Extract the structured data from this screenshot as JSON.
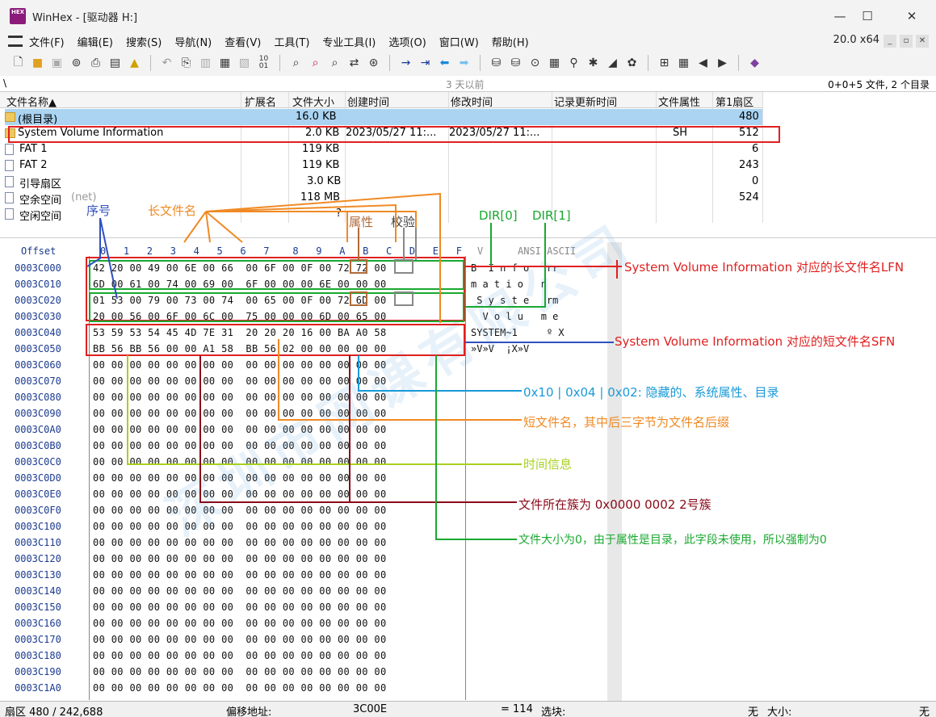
{
  "window": {
    "title": "WinHex - [驱动器 H:]",
    "icon_label": "HEX"
  },
  "menu": [
    "文件(F)",
    "编辑(E)",
    "搜索(S)",
    "导航(N)",
    "查看(V)",
    "工具(T)",
    "专业工具(I)",
    "选项(O)",
    "窗口(W)",
    "帮助(H)"
  ],
  "zoom": "20.0 x64",
  "path": {
    "left": "\\",
    "mid": "3 天以前",
    "right": "0+0+5 文件, 2 个目录"
  },
  "file_columns": [
    "文件名称▲",
    "扩展名",
    "文件大小",
    "创建时间",
    "修改时间",
    "记录更新时间",
    "文件属性",
    "第1扇区"
  ],
  "files": [
    {
      "name": "(根目录)",
      "ext": "",
      "size": "16.0 KB",
      "created": "",
      "modified": "",
      "attr": "",
      "sector": "480"
    },
    {
      "name": "System Volume Information",
      "ext": "",
      "size": "2.0 KB",
      "created": "2023/05/27  11:...",
      "modified": "2023/05/27  11:...",
      "attr": "SH",
      "sector": "512"
    },
    {
      "name": "FAT 1",
      "ext": "",
      "size": "119 KB",
      "created": "",
      "modified": "",
      "attr": "",
      "sector": "6"
    },
    {
      "name": "FAT 2",
      "ext": "",
      "size": "119 KB",
      "created": "",
      "modified": "",
      "attr": "",
      "sector": "243"
    },
    {
      "name": "引导扇区",
      "ext": "",
      "size": "3.0 KB",
      "created": "",
      "modified": "",
      "attr": "",
      "sector": "0"
    },
    {
      "name": "空余空间",
      "name_suffix": "(net)",
      "ext": "",
      "size": "118 MB",
      "created": "",
      "modified": "",
      "attr": "",
      "sector": "524"
    },
    {
      "name": "空闲空间",
      "ext": "",
      "size": "?",
      "created": "",
      "modified": "",
      "attr": "",
      "sector": ""
    }
  ],
  "hex": {
    "header_offset": "Offset",
    "header_cols": "0   1   2   3   4   5   6   7    8   9   A   B   C   D   E   F",
    "header_ascii": "ANSI ASCII",
    "header_v": "V",
    "rows": [
      {
        "off": "0003C000",
        "hex": "42 20 00 49 00 6E 00 66  00 6F 00 0F 00 72 72 00",
        "ascii": "B  I n f o   rr"
      },
      {
        "off": "0003C010",
        "hex": "6D 00 61 00 74 00 69 00  6F 00 00 00 6E 00 00 00",
        "ascii": "m a t i o   n"
      },
      {
        "off": "0003C020",
        "hex": "01 53 00 79 00 73 00 74  00 65 00 0F 00 72 6D 00",
        "ascii": " S y s t e   rm"
      },
      {
        "off": "0003C030",
        "hex": "20 00 56 00 6F 00 6C 00  75 00 00 00 6D 00 65 00",
        "ascii": "  V o l u   m e"
      },
      {
        "off": "0003C040",
        "hex": "53 59 53 54 45 4D 7E 31  20 20 20 16 00 BA A0 58",
        "ascii": "SYSTEM~1     º X"
      },
      {
        "off": "0003C050",
        "hex": "BB 56 BB 56 00 00 A1 58  BB 56 02 00 00 00 00 00",
        "ascii": "»V»V  ¡X»V"
      },
      {
        "off": "0003C060",
        "hex": "00 00 00 00 00 00 00 00  00 00 00 00 00 00 00 00",
        "ascii": ""
      },
      {
        "off": "0003C070",
        "hex": "00 00 00 00 00 00 00 00  00 00 00 00 00 00 00 00",
        "ascii": ""
      },
      {
        "off": "0003C080",
        "hex": "00 00 00 00 00 00 00 00  00 00 00 00 00 00 00 00",
        "ascii": ""
      },
      {
        "off": "0003C090",
        "hex": "00 00 00 00 00 00 00 00  00 00 00 00 00 00 00 00",
        "ascii": ""
      },
      {
        "off": "0003C0A0",
        "hex": "00 00 00 00 00 00 00 00  00 00 00 00 00 00 00 00",
        "ascii": ""
      },
      {
        "off": "0003C0B0",
        "hex": "00 00 00 00 00 00 00 00  00 00 00 00 00 00 00 00",
        "ascii": ""
      },
      {
        "off": "0003C0C0",
        "hex": "00 00 00 00 00 00 00 00  00 00 00 00 00 00 00 00",
        "ascii": ""
      },
      {
        "off": "0003C0D0",
        "hex": "00 00 00 00 00 00 00 00  00 00 00 00 00 00 00 00",
        "ascii": ""
      },
      {
        "off": "0003C0E0",
        "hex": "00 00 00 00 00 00 00 00  00 00 00 00 00 00 00 00",
        "ascii": ""
      },
      {
        "off": "0003C0F0",
        "hex": "00 00 00 00 00 00 00 00  00 00 00 00 00 00 00 00",
        "ascii": ""
      },
      {
        "off": "0003C100",
        "hex": "00 00 00 00 00 00 00 00  00 00 00 00 00 00 00 00",
        "ascii": ""
      },
      {
        "off": "0003C110",
        "hex": "00 00 00 00 00 00 00 00  00 00 00 00 00 00 00 00",
        "ascii": ""
      },
      {
        "off": "0003C120",
        "hex": "00 00 00 00 00 00 00 00  00 00 00 00 00 00 00 00",
        "ascii": ""
      },
      {
        "off": "0003C130",
        "hex": "00 00 00 00 00 00 00 00  00 00 00 00 00 00 00 00",
        "ascii": ""
      },
      {
        "off": "0003C140",
        "hex": "00 00 00 00 00 00 00 00  00 00 00 00 00 00 00 00",
        "ascii": ""
      },
      {
        "off": "0003C150",
        "hex": "00 00 00 00 00 00 00 00  00 00 00 00 00 00 00 00",
        "ascii": ""
      },
      {
        "off": "0003C160",
        "hex": "00 00 00 00 00 00 00 00  00 00 00 00 00 00 00 00",
        "ascii": ""
      },
      {
        "off": "0003C170",
        "hex": "00 00 00 00 00 00 00 00  00 00 00 00 00 00 00 00",
        "ascii": ""
      },
      {
        "off": "0003C180",
        "hex": "00 00 00 00 00 00 00 00  00 00 00 00 00 00 00 00",
        "ascii": ""
      },
      {
        "off": "0003C190",
        "hex": "00 00 00 00 00 00 00 00  00 00 00 00 00 00 00 00",
        "ascii": ""
      },
      {
        "off": "0003C1A0",
        "hex": "00 00 00 00 00 00 00 00  00 00 00 00 00 00 00 00",
        "ascii": ""
      }
    ]
  },
  "annotations": {
    "seq": "序号",
    "lfn_name": "长文件名",
    "attr": "属性",
    "checksum": "校验",
    "dir0": "DIR[0]",
    "dir1": "DIR[1]",
    "lfn_desc": "System Volume Information 对应的长文件名LFN",
    "sfn_desc": "System Volume Information 对应的短文件名SFN",
    "attr_desc": "0x10 | 0x04 | 0x02: 隐藏的、系统属性、目录",
    "sfn_name_desc": "短文件名，其中后三字节为文件名后缀",
    "time_desc": "时间信息",
    "cluster_desc": "文件所在簇为 0x0000 0002 2号簇",
    "size_desc": "文件大小为0，由于属性是目录，此字段未使用，所以强制为0"
  },
  "status": {
    "sector": "扇区 480 / 242,688",
    "offset_label": "偏移地址:",
    "offset_value": "3C00E",
    "eq": "= 114",
    "select_label": "选块:",
    "none1": "无",
    "size_label": "大小:",
    "none2": "无"
  },
  "colors": {
    "red": "#e02020",
    "green": "#1aa830",
    "orange": "#f08a24",
    "blue": "#3050c0",
    "lime": "#a8d020",
    "cyan": "#1a9ad8",
    "darkred": "#8a0a1a",
    "brown": "#b06a3a"
  }
}
